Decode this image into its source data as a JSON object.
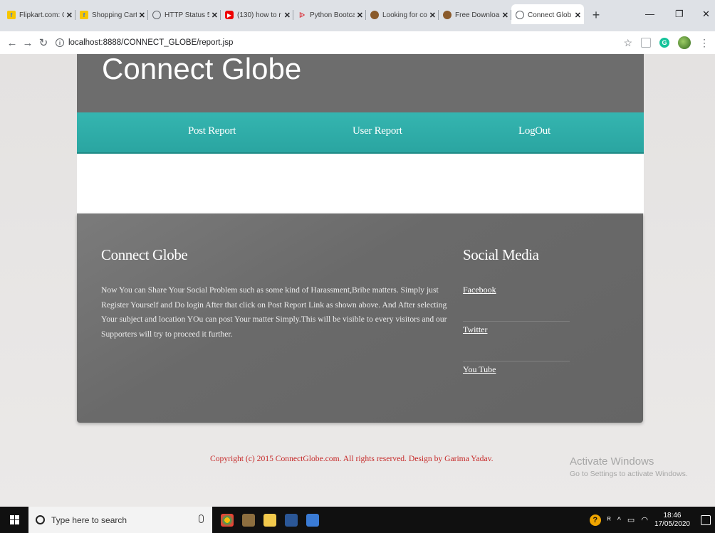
{
  "browser": {
    "tabs": [
      {
        "title": "Flipkart.com: C",
        "icon": "flipkart-icon"
      },
      {
        "title": "Shopping Cart",
        "icon": "flipkart-icon"
      },
      {
        "title": "HTTP Status 50",
        "icon": "globe-icon"
      },
      {
        "title": "(130) how to r",
        "icon": "youtube-icon"
      },
      {
        "title": "Python Bootca",
        "icon": "udemy-icon"
      },
      {
        "title": "Looking for co",
        "icon": "ball-icon"
      },
      {
        "title": "Free Downloa",
        "icon": "ball-icon"
      },
      {
        "title": "Connect Glob",
        "icon": "globe-icon",
        "active": true
      }
    ],
    "url": "localhost:8888/CONNECT_GLOBE/report.jsp"
  },
  "site": {
    "title": "Connect Globe",
    "nav": {
      "post_report": "Post Report",
      "user_report": "User Report",
      "logout": "LogOut"
    },
    "footer": {
      "about_heading": "Connect Globe",
      "about_text": "Now You can Share Your Social Problem such as some kind of Harassment,Bribe matters. Simply just Register Yourself and Do login After that click on Post Report Link as shown above. And After selecting Your subject and location YOu can post Your matter Simply.This will be visible to every visitors and our Supporters will try to proceed it further.",
      "social_heading": "Social Media",
      "social_links": [
        "Facebook",
        "Twitter",
        "You Tube"
      ]
    },
    "copyright": "Copyright (c) 2015 ConnectGlobe.com. All rights reserved. Design by Garima Yadav."
  },
  "windows": {
    "activate_title": "Activate Windows",
    "activate_sub": "Go to Settings to activate Windows.",
    "search_placeholder": "Type here to search",
    "time": "18:46",
    "date": "17/05/2020"
  },
  "colors": {
    "header_bg": "#6d6d6d",
    "nav_bg": "#2fada9",
    "footer_bg": "#6a6a6a",
    "copyright": "#c62828"
  }
}
